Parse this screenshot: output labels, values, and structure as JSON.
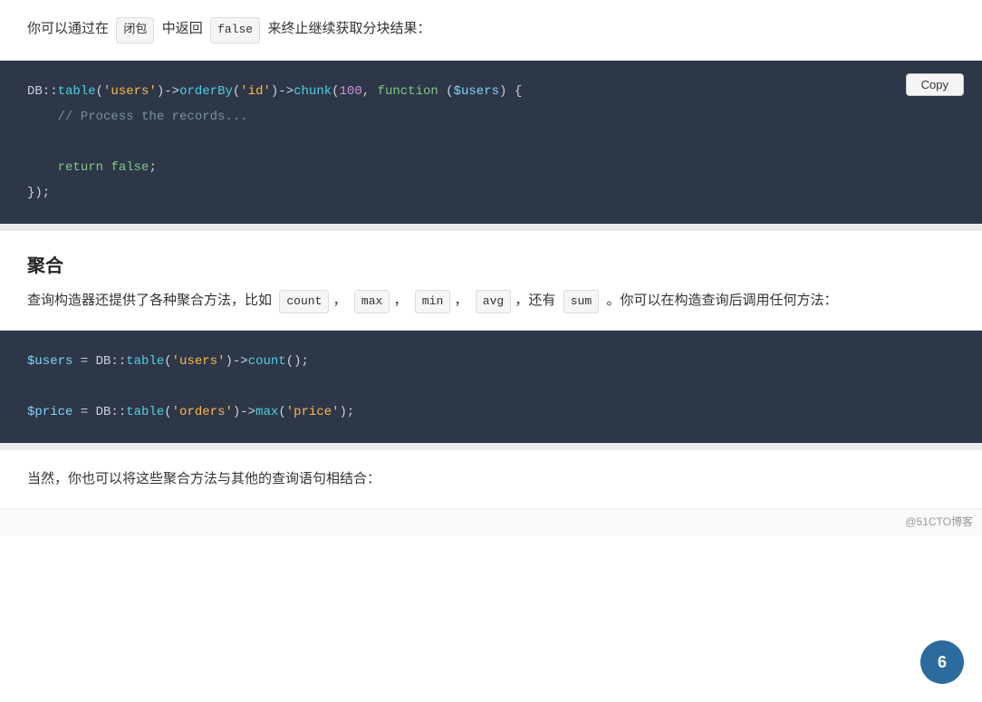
{
  "intro_text": {
    "prefix": "你可以通过在",
    "badge1": "闭包",
    "middle": "中返回",
    "badge2": "false",
    "suffix": "来终止继续获取分块结果："
  },
  "code_block_1": {
    "copy_label": "Copy",
    "lines": [
      {
        "type": "code"
      },
      {
        "type": "comment",
        "text": "    // Process the records..."
      },
      {
        "type": "blank"
      },
      {
        "type": "return"
      },
      {
        "type": "close"
      }
    ]
  },
  "aggregates_section": {
    "heading": "聚合",
    "desc_prefix": "查询构造器还提供了各种聚合方法，比如",
    "methods": [
      "count",
      "max",
      "min",
      "avg",
      "sum"
    ],
    "desc_suffix": "。你可以在构造查询后调用任何方法："
  },
  "code_block_2": {
    "line1_comment": "$users = DB::table('users')->count();",
    "line2_comment": "$price = DB::table('orders')->max('price');"
  },
  "bottom_text": {
    "text": "当然，你也可以将这些聚合方法与其他的查询语句相结合："
  },
  "watermark": {
    "label": "6"
  },
  "footer": {
    "text": "@51CTO博客"
  }
}
